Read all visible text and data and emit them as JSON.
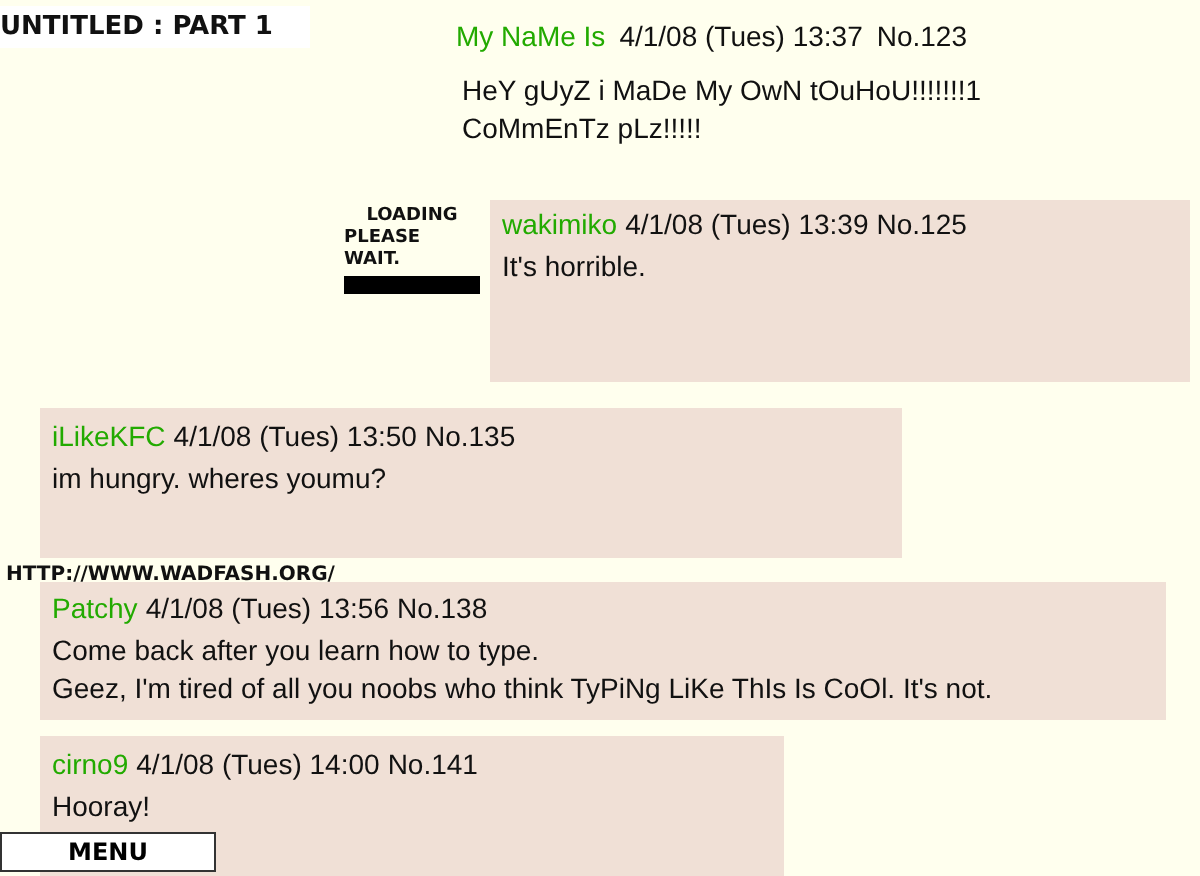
{
  "title": "UNTITLED : PART 1",
  "posts": [
    {
      "kind": "op",
      "name": "My NaMe Is",
      "date": "4/1/08 (Tues) 13:37",
      "number": "No.123",
      "body": [
        "HeY gUyZ i MaDe My OwN tOuHoU!!!!!!!1",
        "CoMmEnTz pLz!!!!!"
      ]
    },
    {
      "kind": "reply",
      "name": "wakimiko",
      "date": "4/1/08 (Tues) 13:39",
      "number": "No.125",
      "body": [
        "It's horrible."
      ]
    },
    {
      "kind": "reply",
      "name": "iLikeKFC",
      "date": "4/1/08 (Tues) 13:50",
      "number": "No.135",
      "body": [
        "im hungry. wheres youmu?"
      ]
    },
    {
      "kind": "reply",
      "name": "Patchy",
      "date": "4/1/08 (Tues) 13:56",
      "number": "No.138",
      "body": [
        "Come back after you learn how to type.",
        "Geez, I'm tired of all you noobs who think TyPiNg LiKe ThIs Is CoOl. It's not."
      ]
    },
    {
      "kind": "reply",
      "name": "cirno9",
      "date": "4/1/08 (Tues) 14:00",
      "number": "No.141",
      "body": [
        "Hooray!"
      ]
    }
  ],
  "loading": [
    "LOADING",
    "PLEASE WAIT."
  ],
  "url": "HTTP://WWW.WADFASH.ORG/",
  "menu": "MENU"
}
